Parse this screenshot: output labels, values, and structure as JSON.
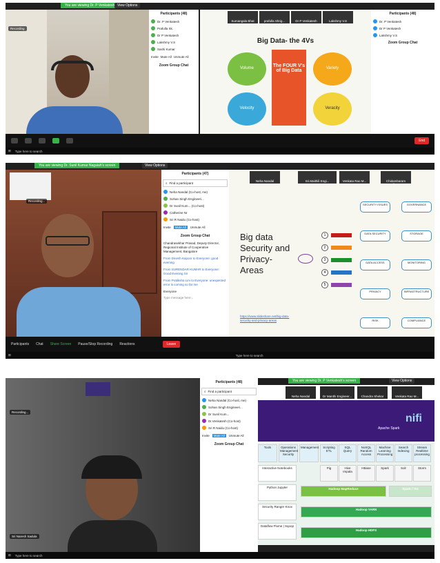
{
  "panel1": {
    "share_banner": "You are viewing Dr. P Venkatesh's screen",
    "view_options": "View Options",
    "recording": "Recording",
    "participants_header": "Participants (48)",
    "participants": [
      "Dr. P Venkatesh",
      "Prafulla Sk.",
      "Dr P Venkatesh",
      "Lakshmy V.S",
      "Sashi Kumar"
    ],
    "thumbs": [
      "Sumangala Bhat",
      "prafulla Shrig...",
      "Dr P Venkatesh",
      "Lakshmy V.S"
    ],
    "slide_title": "Big Data- the 4Vs",
    "slide_center": "The FOUR V's of Big Data",
    "slide_volume": "Volume",
    "slide_velocity": "Velocity",
    "slide_variety": "Variety",
    "slide_veracity": "Veracity",
    "chat_label": "Zoom Group Chat",
    "buttons": [
      "Invite",
      "Mute All",
      "Unmute All"
    ],
    "end_label": "End",
    "win_search": "Type here to search"
  },
  "panel2": {
    "share_banner": "You are viewing Dr. Sunil Kumar Nagaiah's screen",
    "view_options": "View Options",
    "recording": "Recording...",
    "participants_header": "Participants (47)",
    "find": "Find a participant",
    "participants": [
      "Neha Nandal (Co-host, me)",
      "Sohan Singh Engineeri...",
      "Dr Sunil Kum... (Co-host)",
      "Catherine Nr",
      "Sri R Naidu (Co-host)"
    ],
    "buttons": [
      "Invite",
      "Mute All",
      "Unmute All"
    ],
    "chat_label": "Zoom Group Chat",
    "chat_lines": [
      "Chandrasekhar Prasad, Deputy Director, Regional Institute of Cooperative Management, Bangalore",
      "From Dinesh Kapoor to Everyone: good evening",
      "From SURENDAR KUMAR to Everyone: Good Evening Sir",
      "From Pratiksha Lim to Everyone: unexpected error is coming so far me"
    ],
    "chat_to": "Everyone",
    "chat_placeholder": "Type message here...",
    "thumbs": [
      "Neha Nandal",
      "Sri.Maithili Engi...",
      "Venkata Rao M...",
      "Chidambaram Nilam..."
    ],
    "slide_title": "Big data Security and Privacy-Areas",
    "slide_link": "https://www.slideshare.net/big-data-security-and-privacy-areas",
    "nodes": [
      "1",
      "2",
      "3",
      "4",
      "5"
    ],
    "branches": [
      "SECURITY ISSUES",
      "DATA SECURITY",
      "DATA ACCESS",
      "PRIVACY",
      "RISK",
      "GOVERNANCE",
      "STORAGE",
      "MONITORING",
      "INFRASTRUCTURE",
      "COMPLIANCE"
    ],
    "toolbar": [
      "Participants",
      "Chat",
      "Share Screen",
      "Pause/Stop Recording",
      "Reactions"
    ],
    "end_label": "Leave",
    "win_search": "Type here to search"
  },
  "panel3": {
    "share_banner": "You are viewing Dr. P Venkatesh's screen",
    "view_options": "View Options",
    "recording": "Recording...",
    "participants_header": "Participants (48)",
    "find": "Find a participant",
    "participants": [
      "Neha Nandal (Co-host, me)",
      "Sohan Singh Engineeri...",
      "Dr Sunil Kum...",
      "Dr.Venkatesh (Co-host)",
      "Sri R Naidu (Co-host)"
    ],
    "buttons": [
      "Invite",
      "Mute All",
      "Unmute All"
    ],
    "chat_label": "Zoom Group Chat",
    "thumbs": [
      "Neha Nandal",
      "Dr Manthi Engineer...",
      "Chandra Shekar",
      "Venkata Rao M..."
    ],
    "name_label": "Sri Naresh Sadula",
    "spark": "Apache Spark",
    "nifi": "nifi",
    "col_headers": [
      "Tools",
      "Operations Management Security",
      "Management",
      "Scripting ETL",
      "SQL Query",
      "NoSQL Random Access",
      "Machine Learning Processing",
      "Search Indexing",
      "Stream Realtime processing"
    ],
    "cells": [
      "Pig",
      "Hive Impala",
      "HBase",
      "Spark",
      "Solr",
      "Storm"
    ],
    "bars": [
      "Hadoop MapReduce",
      "Hadoop YARN",
      "Hadoop HDFS",
      "Spark / Tez"
    ],
    "left_labels": [
      "Interactive Notebooks",
      "Python Jupyter",
      "Security Ranger Knox",
      "Dataflow Flume | Sqoop"
    ],
    "win_search": "Type here to search"
  }
}
